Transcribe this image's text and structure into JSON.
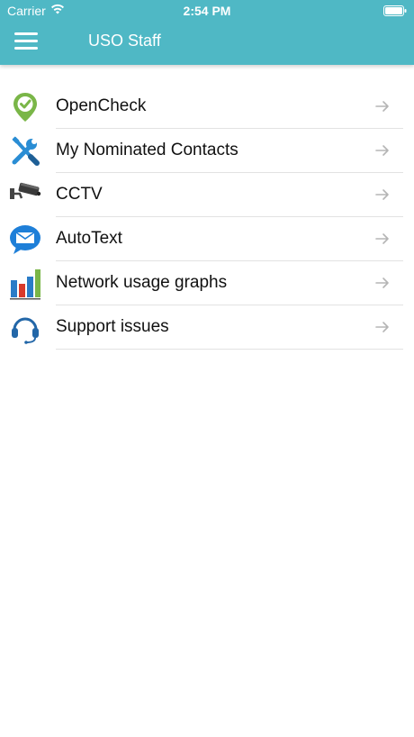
{
  "status_bar": {
    "carrier": "Carrier",
    "time": "2:54 PM"
  },
  "nav": {
    "title": "USO Staff"
  },
  "menu": {
    "items": [
      {
        "label": "OpenCheck",
        "icon": "check-pin-icon"
      },
      {
        "label": "My Nominated Contacts",
        "icon": "tools-icon"
      },
      {
        "label": "CCTV",
        "icon": "camera-icon"
      },
      {
        "label": "AutoText",
        "icon": "message-icon"
      },
      {
        "label": "Network usage graphs",
        "icon": "bar-chart-icon"
      },
      {
        "label": "Support issues",
        "icon": "headset-icon"
      }
    ]
  },
  "colors": {
    "header": "#4fb8c5",
    "opencheck_green": "#7ab648",
    "tools_blue": "#2a8dd4",
    "message_blue": "#1e7fd8",
    "headset_blue": "#2367a8"
  }
}
